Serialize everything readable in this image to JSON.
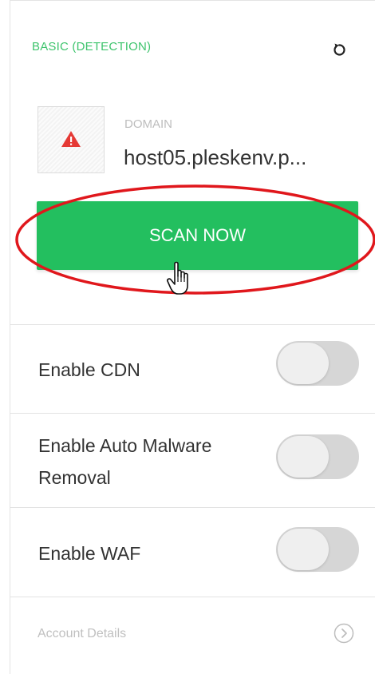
{
  "header": {
    "plan_label": "BASIC (DETECTION)",
    "reset_icon": "reset-icon"
  },
  "site": {
    "thumbnail_icon": "warning-triangle-icon",
    "domain_label": "DOMAIN",
    "domain_value": "host05.pleskenv.p..."
  },
  "scan": {
    "button_label": "SCAN NOW"
  },
  "settings": [
    {
      "label": "Enable CDN",
      "enabled": false
    },
    {
      "label_line1": "Enable Auto Malware",
      "label_line2": "Removal",
      "enabled": false
    },
    {
      "label": "Enable WAF",
      "enabled": false
    }
  ],
  "footer": {
    "account_label": "Account Details",
    "chevron_icon": "chevron-right-circle-icon"
  },
  "colors": {
    "accent_green": "#23bf5f",
    "label_green": "#3ec46d",
    "annotation_red": "#e0171c",
    "warning_red": "#e53935"
  }
}
